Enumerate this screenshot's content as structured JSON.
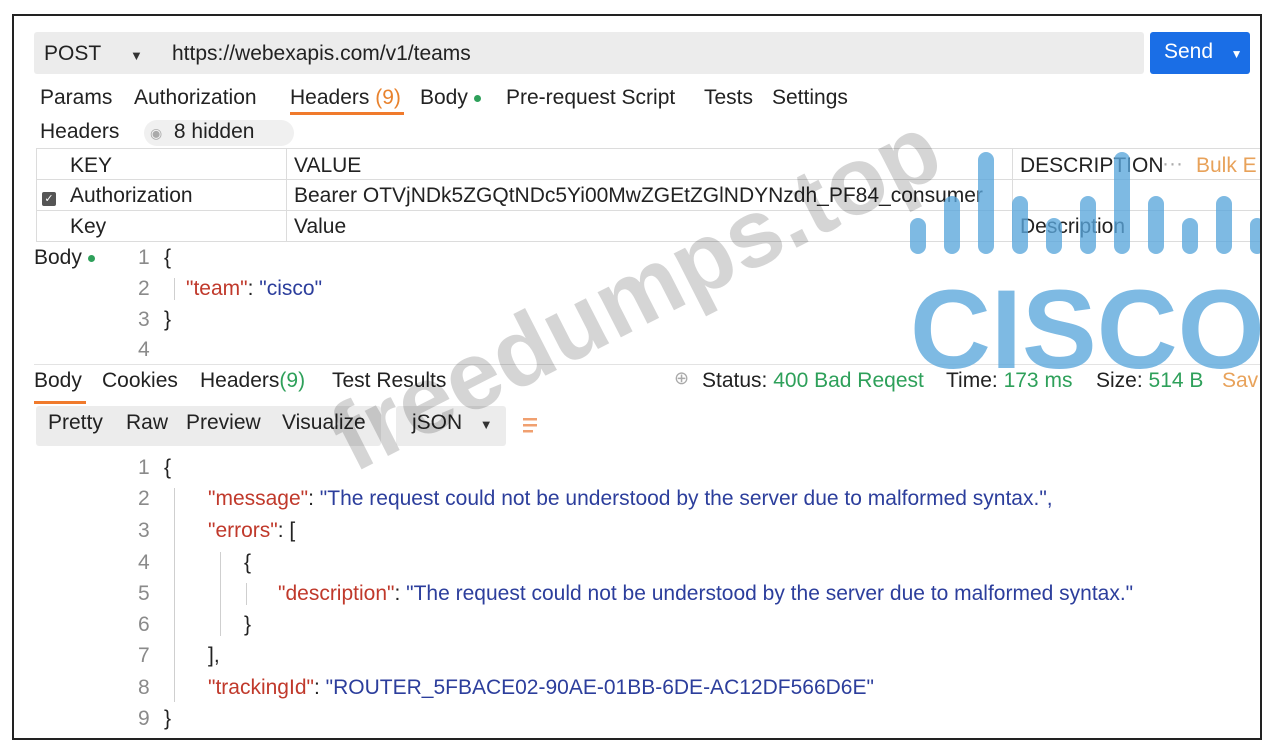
{
  "request": {
    "method": "POST",
    "url": "https://webexapis.com/v1/teams",
    "send_label": "Send"
  },
  "request_tabs": {
    "params": "Params",
    "authorization": "Authorization",
    "headers": "Headers",
    "headers_count": "(9)",
    "body": "Body",
    "prerequest": "Pre-request Script",
    "tests": "Tests",
    "settings": "Settings"
  },
  "headers_section": {
    "label": "Headers",
    "hidden_text": "8 hidden",
    "columns": {
      "key": "KEY",
      "value": "VALUE",
      "description": "DESCRIPTION",
      "bulk": "Bulk E"
    },
    "row": {
      "key": "Authorization",
      "value": "Bearer OTVjNDk5ZGQtNDc5Yi00MwZGEtZGlNDYNzdh_PF84_consumer"
    },
    "placeholder": {
      "key": "Key",
      "value": "Value",
      "description": "Description"
    }
  },
  "request_body": {
    "label": "Body",
    "lines": [
      "1",
      "2",
      "3",
      "4"
    ],
    "open": "{",
    "team_key": "\"team\"",
    "team_value": "\"cisco\"",
    "close": "}"
  },
  "response_tabs": {
    "body": "Body",
    "cookies": "Cookies",
    "headers": "Headers",
    "headers_count": "(9)",
    "test_results": "Test Results"
  },
  "status": {
    "status_label": "Status:",
    "status_value": "400 Bad Reqest",
    "time_label": "Time:",
    "time_value": "173 ms",
    "size_label": "Size:",
    "size_value": "514 B",
    "save": "Sav"
  },
  "format": {
    "pretty": "Pretty",
    "raw": "Raw",
    "preview": "Preview",
    "visualize": "Visualize",
    "type": "jSON"
  },
  "response_body": {
    "lines": [
      "1",
      "2",
      "3",
      "4",
      "5",
      "6",
      "7",
      "8",
      "9"
    ],
    "open": "{",
    "message_key": "\"message\"",
    "message_value": "\"The request could not be understood by the server due to malformed syntax.\",",
    "errors_key": "\"errors\"",
    "errors_open": ": [",
    "obj_open": "{",
    "description_key": "\"description\"",
    "description_value": "\"The request could not be understood by the server due to malformed syntax.\"",
    "obj_close": "}",
    "errors_close": "],",
    "tracking_key": "\"trackingId\"",
    "tracking_value": "\"ROUTER_5FBACE02-90AE-01BB-6DE-AC12DF566D6E\"",
    "close": "}"
  },
  "overlays": {
    "watermark": "freedumps.top",
    "logo": "CISCO"
  },
  "colors": {
    "accent": "#f07a2c",
    "send": "#1a6ee6",
    "status_ok": "#2ea05a",
    "json_key": "#c0392b",
    "json_string": "#2c3e9c",
    "cisco_blue": "#5aa7dc"
  }
}
